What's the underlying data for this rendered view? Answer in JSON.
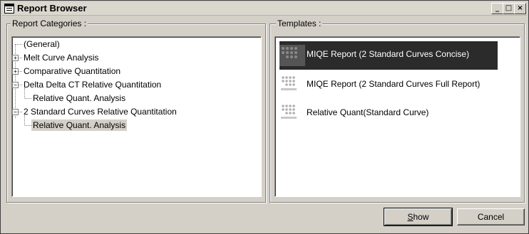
{
  "window": {
    "title": "Report Browser"
  },
  "title_buttons": {
    "minimize": "_",
    "maximize": "□",
    "close": "×"
  },
  "categories": {
    "label": "Report Categories :",
    "items": [
      {
        "label": "(General)",
        "expander": ""
      },
      {
        "label": "Melt Curve Analysis",
        "expander": "+"
      },
      {
        "label": "Comparative Quantitation",
        "expander": "+"
      },
      {
        "label": "Delta Delta CT Relative Quantitation",
        "expander": "−"
      },
      {
        "label": "Relative Quant. Analysis",
        "expander": ""
      },
      {
        "label": "2 Standard Curves Relative Quantitation",
        "expander": "−"
      },
      {
        "label": "Relative Quant. Analysis",
        "expander": "",
        "selected": true
      }
    ]
  },
  "templates": {
    "label": "Templates :",
    "items": [
      {
        "label": "MIQE Report (2 Standard Curves Concise)",
        "selected": true,
        "icon": "qiagen-report-icon"
      },
      {
        "label": "MIQE Report (2 Standard Curves Full Report)",
        "selected": false,
        "icon": "qiagen-report-icon"
      },
      {
        "label": "Relative Quant(Standard Curve)",
        "selected": false,
        "icon": "qiagen-report-icon"
      }
    ]
  },
  "buttons": {
    "show": "Show",
    "cancel": "Cancel"
  },
  "colors": {
    "selection": "#2b2b2b",
    "face": "#d4d0c8"
  }
}
